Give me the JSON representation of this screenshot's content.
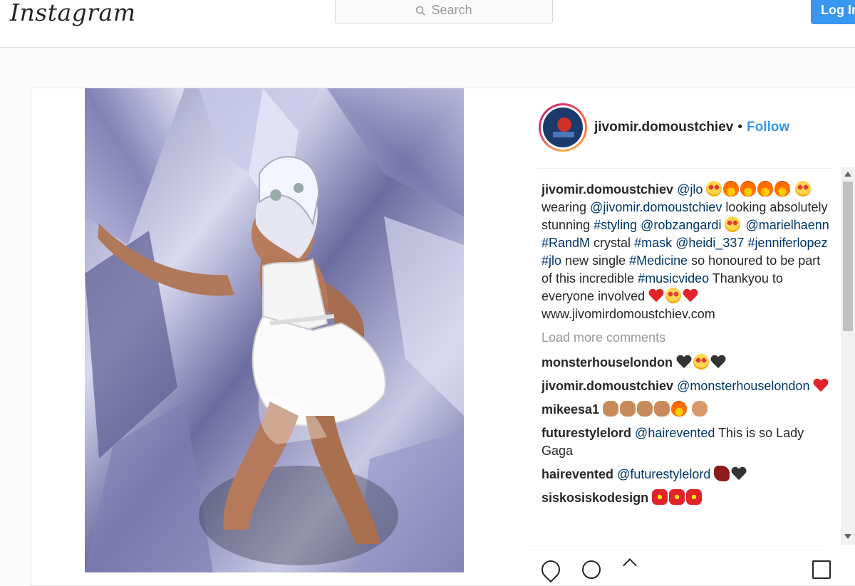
{
  "app": {
    "logo": "Instagram",
    "search_placeholder": "Search",
    "login_label": "Log In"
  },
  "post": {
    "author": "jivomir.domoustchiev",
    "separator": "•",
    "follow_label": "Follow",
    "caption": {
      "user": "jivomir.domoustchiev",
      "segments": [
        {
          "t": "link",
          "v": "@jlo"
        },
        {
          "t": "text",
          "v": " "
        },
        {
          "t": "emoji",
          "v": "heart-eyes"
        },
        {
          "t": "emoji",
          "v": "fire"
        },
        {
          "t": "emoji",
          "v": "fire"
        },
        {
          "t": "emoji",
          "v": "fire"
        },
        {
          "t": "emoji",
          "v": "fire"
        },
        {
          "t": "text",
          "v": " "
        },
        {
          "t": "emoji",
          "v": "heart-eyes"
        },
        {
          "t": "text",
          "v": " wearing "
        },
        {
          "t": "link",
          "v": "@jivomir.domoustchiev"
        },
        {
          "t": "text",
          "v": " looking absolutely stunning "
        },
        {
          "t": "link",
          "v": "#styling"
        },
        {
          "t": "text",
          "v": " "
        },
        {
          "t": "link",
          "v": "@robzangardi"
        },
        {
          "t": "text",
          "v": " "
        },
        {
          "t": "emoji",
          "v": "heart-eyes"
        },
        {
          "t": "text",
          "v": " "
        },
        {
          "t": "link",
          "v": "@marielhaenn"
        },
        {
          "t": "text",
          "v": " "
        },
        {
          "t": "link",
          "v": "#RandM"
        },
        {
          "t": "text",
          "v": " crystal "
        },
        {
          "t": "link",
          "v": "#mask"
        },
        {
          "t": "text",
          "v": " "
        },
        {
          "t": "link",
          "v": "@heidi_337"
        },
        {
          "t": "text",
          "v": " "
        },
        {
          "t": "link",
          "v": "#jenniferlopez"
        },
        {
          "t": "text",
          "v": " "
        },
        {
          "t": "link",
          "v": "#jlo"
        },
        {
          "t": "text",
          "v": " new single "
        },
        {
          "t": "link",
          "v": "#Medicine"
        },
        {
          "t": "text",
          "v": " so honoured to be part of this incredible "
        },
        {
          "t": "link",
          "v": "#musicvideo"
        },
        {
          "t": "text",
          "v": " Thankyou to everyone involved "
        },
        {
          "t": "emoji",
          "v": "heart-red"
        },
        {
          "t": "emoji",
          "v": "heart-eyes"
        },
        {
          "t": "emoji",
          "v": "heart-red"
        },
        {
          "t": "text",
          "v": " www.jivomirdomoustchiev.com"
        }
      ]
    },
    "load_more_label": "Load more comments",
    "comments": [
      {
        "user": "monsterhouselondon",
        "segments": [
          {
            "t": "text",
            "v": " "
          },
          {
            "t": "emoji",
            "v": "heart-black"
          },
          {
            "t": "emoji",
            "v": "heart-eyes"
          },
          {
            "t": "emoji",
            "v": "heart-black"
          }
        ]
      },
      {
        "user": "jivomir.domoustchiev",
        "segments": [
          {
            "t": "text",
            "v": " "
          },
          {
            "t": "link",
            "v": "@monsterhouselondon"
          },
          {
            "t": "text",
            "v": " "
          },
          {
            "t": "emoji",
            "v": "heart-red"
          }
        ]
      },
      {
        "user": "mikeesa1",
        "segments": [
          {
            "t": "text",
            "v": " "
          },
          {
            "t": "emoji",
            "v": "clap"
          },
          {
            "t": "emoji",
            "v": "clap"
          },
          {
            "t": "emoji",
            "v": "clap"
          },
          {
            "t": "emoji",
            "v": "clap"
          },
          {
            "t": "emoji",
            "v": "fire"
          },
          {
            "t": "text",
            "v": " "
          },
          {
            "t": "emoji",
            "v": "fist"
          }
        ]
      },
      {
        "user": "futurestylelord",
        "segments": [
          {
            "t": "text",
            "v": " "
          },
          {
            "t": "link",
            "v": "@hairevented"
          },
          {
            "t": "text",
            "v": " This is so Lady Gaga"
          }
        ]
      },
      {
        "user": "hairevented",
        "segments": [
          {
            "t": "text",
            "v": " "
          },
          {
            "t": "link",
            "v": "@futurestylelord"
          },
          {
            "t": "text",
            "v": " "
          },
          {
            "t": "emoji",
            "v": "lips"
          },
          {
            "t": "emoji",
            "v": "heart-black"
          }
        ]
      },
      {
        "user": "siskosiskodesign",
        "segments": [
          {
            "t": "text",
            "v": " "
          },
          {
            "t": "emoji",
            "v": "sparkle-heart"
          },
          {
            "t": "emoji",
            "v": "sparkle-heart"
          },
          {
            "t": "emoji",
            "v": "sparkle-heart"
          }
        ]
      }
    ]
  }
}
